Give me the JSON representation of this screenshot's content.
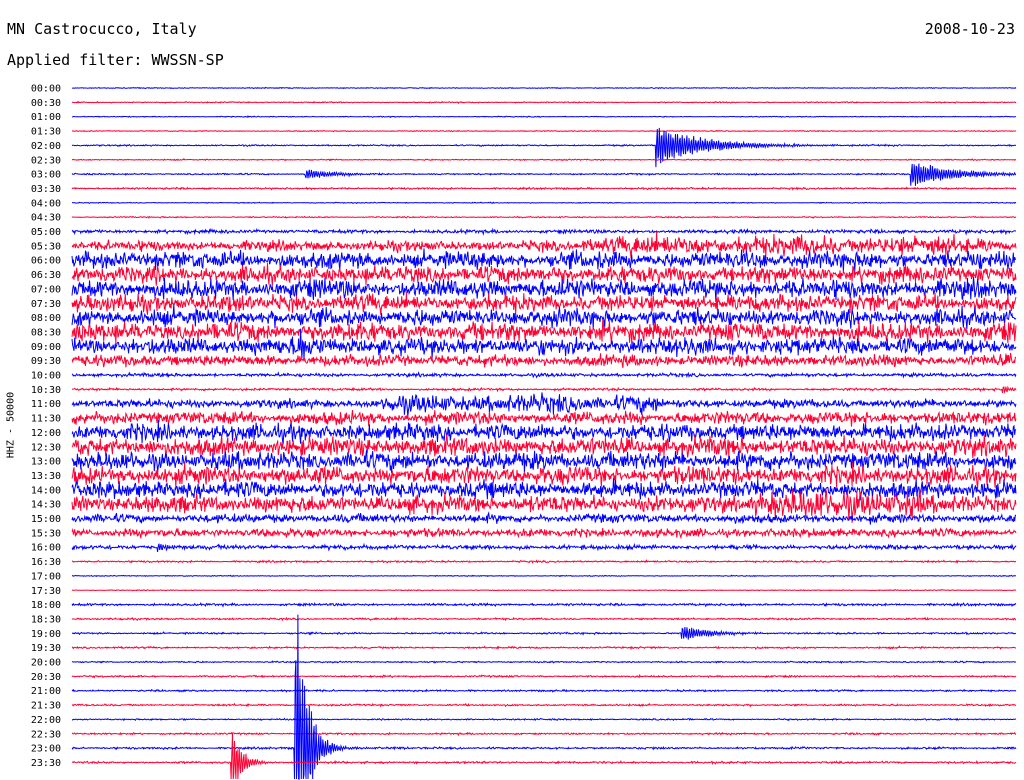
{
  "header": {
    "station": "MN Castrocucco, Italy",
    "date": "2008-10-23",
    "filter": "Applied filter: WWSSN-SP"
  },
  "chart_data": {
    "type": "line",
    "title": "MN Castrocucco, Italy",
    "ylabel": "HHZ - 50000",
    "colors": [
      "#0000ff",
      "#ff0033"
    ],
    "rows": [
      {
        "label": "00:00",
        "noise": 0.3
      },
      {
        "label": "00:30",
        "noise": 0.4
      },
      {
        "label": "01:00",
        "noise": 0.3
      },
      {
        "label": "01:30",
        "noise": 0.3
      },
      {
        "label": "02:00",
        "noise": 0.5,
        "events": [
          {
            "x": 0.618,
            "amp": 22,
            "decay": 0.05
          }
        ]
      },
      {
        "label": "02:30",
        "noise": 0.4
      },
      {
        "label": "03:00",
        "noise": 0.5,
        "events": [
          {
            "x": 0.247,
            "amp": 6,
            "decay": 0.03
          },
          {
            "x": 0.888,
            "amp": 17,
            "decay": 0.04
          }
        ]
      },
      {
        "label": "03:30",
        "noise": 0.6
      },
      {
        "label": "04:00",
        "noise": 0.3
      },
      {
        "label": "04:30",
        "noise": 0.4
      },
      {
        "label": "05:00",
        "noise": 1.2
      },
      {
        "label": "05:30",
        "noise": 3.5,
        "bursts": [
          [
            0.54,
            0.98,
            2.0
          ]
        ]
      },
      {
        "label": "06:00",
        "noise": 6
      },
      {
        "label": "06:30",
        "noise": 6
      },
      {
        "label": "07:00",
        "noise": 6.5
      },
      {
        "label": "07:30",
        "noise": 6
      },
      {
        "label": "08:00",
        "noise": 6
      },
      {
        "label": "08:30",
        "noise": 6.5
      },
      {
        "label": "09:00",
        "noise": 6,
        "events": [
          {
            "x": 0.238,
            "amp": 12,
            "decay": 0.02
          }
        ]
      },
      {
        "label": "09:30",
        "noise": 4
      },
      {
        "label": "10:00",
        "noise": 1.2
      },
      {
        "label": "10:30",
        "noise": 0.8,
        "events": [
          {
            "x": 0.985,
            "amp": 5,
            "decay": 0.01
          }
        ]
      },
      {
        "label": "11:00",
        "noise": 3,
        "bursts": [
          [
            0.33,
            0.62,
            2.2
          ]
        ]
      },
      {
        "label": "11:30",
        "noise": 4.5
      },
      {
        "label": "12:00",
        "noise": 6
      },
      {
        "label": "12:30",
        "noise": 6.5
      },
      {
        "label": "13:00",
        "noise": 6.5
      },
      {
        "label": "13:30",
        "noise": 6.5
      },
      {
        "label": "14:00",
        "noise": 6
      },
      {
        "label": "14:30",
        "noise": 6,
        "bursts": [
          [
            0.72,
            0.9,
            1.8
          ]
        ]
      },
      {
        "label": "15:00",
        "noise": 3
      },
      {
        "label": "15:30",
        "noise": 3
      },
      {
        "label": "16:00",
        "noise": 1.5,
        "events": [
          {
            "x": 0.09,
            "amp": 5,
            "decay": 0.01
          }
        ]
      },
      {
        "label": "16:30",
        "noise": 0.6
      },
      {
        "label": "17:00",
        "noise": 0.3
      },
      {
        "label": "17:30",
        "noise": 0.3
      },
      {
        "label": "18:00",
        "noise": 0.8
      },
      {
        "label": "18:30",
        "noise": 0.6
      },
      {
        "label": "19:00",
        "noise": 0.6,
        "events": [
          {
            "x": 0.645,
            "amp": 9,
            "decay": 0.03
          }
        ]
      },
      {
        "label": "19:30",
        "noise": 0.6
      },
      {
        "label": "20:00",
        "noise": 0.5
      },
      {
        "label": "20:30",
        "noise": 0.6
      },
      {
        "label": "21:00",
        "noise": 0.6
      },
      {
        "label": "21:30",
        "noise": 0.6
      },
      {
        "label": "22:00",
        "noise": 0.5
      },
      {
        "label": "22:30",
        "noise": 0.6
      },
      {
        "label": "23:00",
        "noise": 0.7,
        "events": [
          {
            "x": 0.235,
            "amp": 200,
            "decay": 0.012
          },
          {
            "x": 0.26,
            "amp": 12,
            "decay": 0.008
          }
        ]
      },
      {
        "label": "23:30",
        "noise": 0.7,
        "events": [
          {
            "x": 0.168,
            "amp": 50,
            "decay": 0.01
          }
        ]
      }
    ]
  }
}
